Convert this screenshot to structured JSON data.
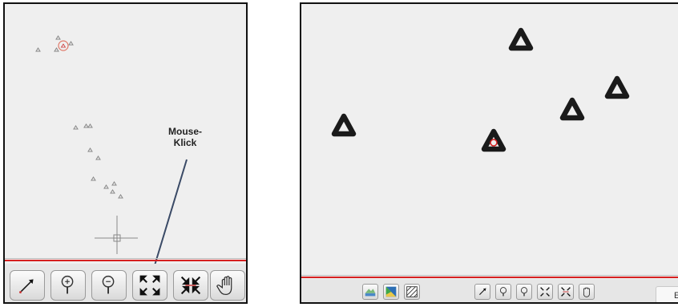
{
  "annotation": {
    "label": "Mouse-\nKlick"
  },
  "left_toolbar": {
    "buttons": [
      {
        "name": "select-point-button",
        "icon": "arrow-point-icon"
      },
      {
        "name": "zoom-in-button",
        "icon": "magnifier-plus-icon"
      },
      {
        "name": "zoom-out-button",
        "icon": "magnifier-minus-icon"
      },
      {
        "name": "zoom-extent-button",
        "icon": "expand-arrows-icon"
      },
      {
        "name": "zoom-selection-button",
        "icon": "collapse-arrows-icon"
      },
      {
        "name": "pan-button",
        "icon": "hand-icon"
      }
    ]
  },
  "right_toolbar": {
    "layer_buttons": [
      {
        "name": "terrain-layer-button",
        "icon": "terrain-icon"
      },
      {
        "name": "map-layer-button",
        "icon": "map-icon"
      },
      {
        "name": "hatch-layer-button",
        "icon": "hatch-icon"
      }
    ],
    "edge_button_label": "E"
  },
  "colors": {
    "accent_line": "#d62020",
    "marker": "#1a1a1a",
    "selected": "#d62020"
  }
}
